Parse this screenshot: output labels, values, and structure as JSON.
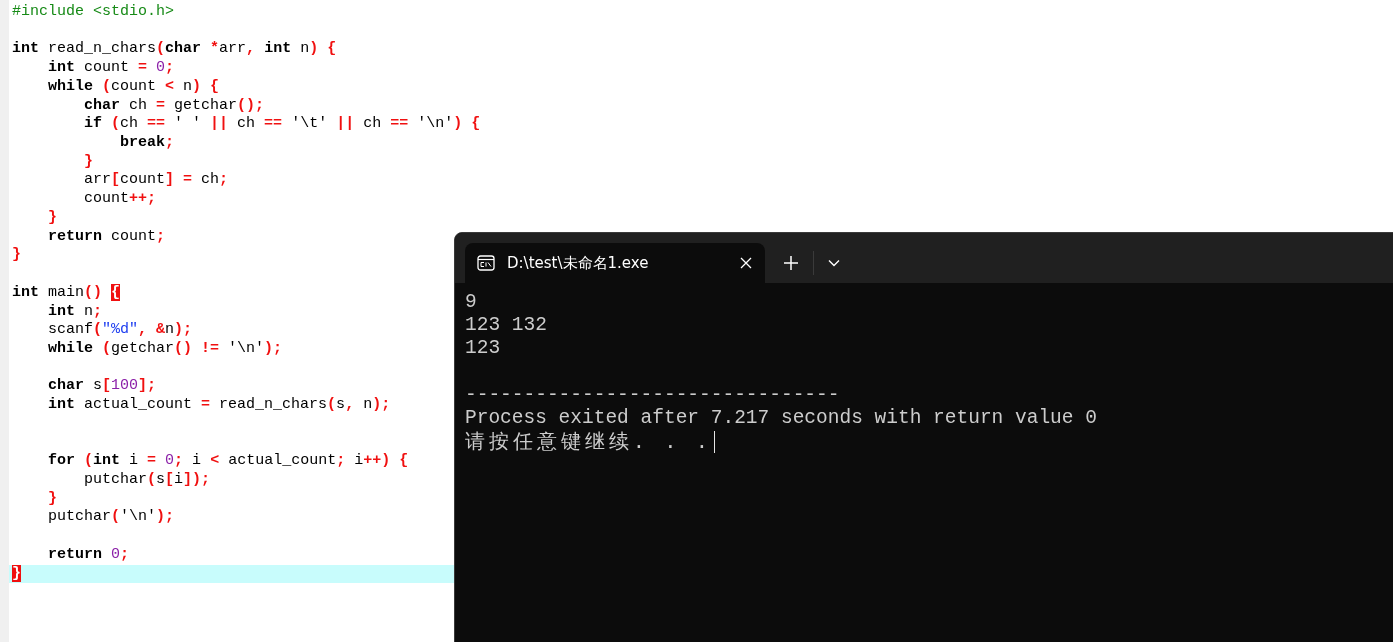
{
  "editor": {
    "lines": [
      {
        "kind": "code",
        "current": false,
        "tokens": [
          {
            "kind": "pre",
            "text": "#include <stdio.h>"
          }
        ]
      },
      {
        "kind": "blank",
        "current": false
      },
      {
        "kind": "code",
        "current": false,
        "tokens": [
          {
            "kind": "kw",
            "text": "int"
          },
          {
            "kind": "id",
            "text": " read_n_chars"
          },
          {
            "kind": "op",
            "text": "("
          },
          {
            "kind": "kw",
            "text": "char"
          },
          {
            "kind": "op",
            "text": " *"
          },
          {
            "kind": "id",
            "text": "arr"
          },
          {
            "kind": "op",
            "text": ","
          },
          {
            "kind": "kw",
            "text": " int"
          },
          {
            "kind": "id",
            "text": " n"
          },
          {
            "kind": "op",
            "text": ")"
          },
          {
            "kind": "op",
            "text": " {"
          }
        ]
      },
      {
        "kind": "code",
        "current": false,
        "tokens": [
          {
            "kind": "kw",
            "text": "    int"
          },
          {
            "kind": "id",
            "text": " count "
          },
          {
            "kind": "op",
            "text": "="
          },
          {
            "kind": "num",
            "text": " 0"
          },
          {
            "kind": "op",
            "text": ";"
          }
        ]
      },
      {
        "kind": "code",
        "current": false,
        "tokens": [
          {
            "kind": "kw",
            "text": "    while"
          },
          {
            "kind": "op",
            "text": " ("
          },
          {
            "kind": "id",
            "text": "count "
          },
          {
            "kind": "op",
            "text": "<"
          },
          {
            "kind": "id",
            "text": " n"
          },
          {
            "kind": "op",
            "text": ")"
          },
          {
            "kind": "op",
            "text": " {"
          }
        ]
      },
      {
        "kind": "code",
        "current": false,
        "tokens": [
          {
            "kind": "kw",
            "text": "        char"
          },
          {
            "kind": "id",
            "text": " ch "
          },
          {
            "kind": "op",
            "text": "="
          },
          {
            "kind": "id",
            "text": " getchar"
          },
          {
            "kind": "op",
            "text": "();"
          }
        ]
      },
      {
        "kind": "code",
        "current": false,
        "tokens": [
          {
            "kind": "kw",
            "text": "        if"
          },
          {
            "kind": "op",
            "text": " ("
          },
          {
            "kind": "id",
            "text": "ch "
          },
          {
            "kind": "op",
            "text": "=="
          },
          {
            "kind": "id",
            "text": " ' ' "
          },
          {
            "kind": "op",
            "text": "||"
          },
          {
            "kind": "id",
            "text": " ch "
          },
          {
            "kind": "op",
            "text": "=="
          },
          {
            "kind": "id",
            "text": " '\\t' "
          },
          {
            "kind": "op",
            "text": "||"
          },
          {
            "kind": "id",
            "text": " ch "
          },
          {
            "kind": "op",
            "text": "=="
          },
          {
            "kind": "id",
            "text": " '\\n'"
          },
          {
            "kind": "op",
            "text": ")"
          },
          {
            "kind": "op",
            "text": " {"
          }
        ]
      },
      {
        "kind": "code",
        "current": false,
        "tokens": [
          {
            "kind": "kw",
            "text": "            break"
          },
          {
            "kind": "op",
            "text": ";"
          }
        ]
      },
      {
        "kind": "code",
        "current": false,
        "tokens": [
          {
            "kind": "op",
            "text": "        }"
          }
        ]
      },
      {
        "kind": "code",
        "current": false,
        "tokens": [
          {
            "kind": "id",
            "text": "        arr"
          },
          {
            "kind": "op",
            "text": "["
          },
          {
            "kind": "id",
            "text": "count"
          },
          {
            "kind": "op",
            "text": "]"
          },
          {
            "kind": "op",
            "text": " ="
          },
          {
            "kind": "id",
            "text": " ch"
          },
          {
            "kind": "op",
            "text": ";"
          }
        ]
      },
      {
        "kind": "code",
        "current": false,
        "tokens": [
          {
            "kind": "id",
            "text": "        count"
          },
          {
            "kind": "op",
            "text": "++;"
          }
        ]
      },
      {
        "kind": "code",
        "current": false,
        "tokens": [
          {
            "kind": "op",
            "text": "    }"
          }
        ]
      },
      {
        "kind": "code",
        "current": false,
        "tokens": [
          {
            "kind": "kw",
            "text": "    return"
          },
          {
            "kind": "id",
            "text": " count"
          },
          {
            "kind": "op",
            "text": ";"
          }
        ]
      },
      {
        "kind": "code",
        "current": false,
        "tokens": [
          {
            "kind": "op",
            "text": "}"
          }
        ]
      },
      {
        "kind": "blank",
        "current": false
      },
      {
        "kind": "code",
        "current": false,
        "tokens": [
          {
            "kind": "kw",
            "text": "int"
          },
          {
            "kind": "id",
            "text": " main"
          },
          {
            "kind": "op",
            "text": "() "
          },
          {
            "kind": "match",
            "text": "{"
          }
        ]
      },
      {
        "kind": "code",
        "current": false,
        "tokens": [
          {
            "kind": "kw",
            "text": "    int"
          },
          {
            "kind": "id",
            "text": " n"
          },
          {
            "kind": "op",
            "text": ";"
          }
        ]
      },
      {
        "kind": "code",
        "current": false,
        "tokens": [
          {
            "kind": "id",
            "text": "    scanf"
          },
          {
            "kind": "op",
            "text": "("
          },
          {
            "kind": "str",
            "text": "\"%d\""
          },
          {
            "kind": "op",
            "text": ","
          },
          {
            "kind": "op",
            "text": " &"
          },
          {
            "kind": "id",
            "text": "n"
          },
          {
            "kind": "op",
            "text": ");"
          }
        ]
      },
      {
        "kind": "code",
        "current": false,
        "tokens": [
          {
            "kind": "kw",
            "text": "    while"
          },
          {
            "kind": "op",
            "text": " ("
          },
          {
            "kind": "id",
            "text": "getchar"
          },
          {
            "kind": "op",
            "text": "()"
          },
          {
            "kind": "op",
            "text": " !="
          },
          {
            "kind": "id",
            "text": " '\\n'"
          },
          {
            "kind": "op",
            "text": ");"
          }
        ]
      },
      {
        "kind": "blank",
        "current": false
      },
      {
        "kind": "code",
        "current": false,
        "tokens": [
          {
            "kind": "kw",
            "text": "    char"
          },
          {
            "kind": "id",
            "text": " s"
          },
          {
            "kind": "op",
            "text": "["
          },
          {
            "kind": "num",
            "text": "100"
          },
          {
            "kind": "op",
            "text": "];"
          }
        ]
      },
      {
        "kind": "code",
        "current": false,
        "tokens": [
          {
            "kind": "kw",
            "text": "    int"
          },
          {
            "kind": "id",
            "text": " actual_count "
          },
          {
            "kind": "op",
            "text": "="
          },
          {
            "kind": "id",
            "text": " read_n_chars"
          },
          {
            "kind": "op",
            "text": "("
          },
          {
            "kind": "id",
            "text": "s"
          },
          {
            "kind": "op",
            "text": ","
          },
          {
            "kind": "id",
            "text": " n"
          },
          {
            "kind": "op",
            "text": ");"
          }
        ]
      },
      {
        "kind": "blank",
        "current": false
      },
      {
        "kind": "blank",
        "current": false
      },
      {
        "kind": "code",
        "current": false,
        "tokens": [
          {
            "kind": "kw",
            "text": "    for"
          },
          {
            "kind": "op",
            "text": " ("
          },
          {
            "kind": "kw",
            "text": "int"
          },
          {
            "kind": "id",
            "text": " i "
          },
          {
            "kind": "op",
            "text": "="
          },
          {
            "kind": "num",
            "text": " 0"
          },
          {
            "kind": "op",
            "text": ";"
          },
          {
            "kind": "id",
            "text": " i "
          },
          {
            "kind": "op",
            "text": "<"
          },
          {
            "kind": "id",
            "text": " actual_count"
          },
          {
            "kind": "op",
            "text": ";"
          },
          {
            "kind": "id",
            "text": " i"
          },
          {
            "kind": "op",
            "text": "++)"
          },
          {
            "kind": "op",
            "text": " {"
          }
        ]
      },
      {
        "kind": "code",
        "current": false,
        "tokens": [
          {
            "kind": "id",
            "text": "        putchar"
          },
          {
            "kind": "op",
            "text": "("
          },
          {
            "kind": "id",
            "text": "s"
          },
          {
            "kind": "op",
            "text": "["
          },
          {
            "kind": "id",
            "text": "i"
          },
          {
            "kind": "op",
            "text": "]);"
          }
        ]
      },
      {
        "kind": "code",
        "current": false,
        "tokens": [
          {
            "kind": "op",
            "text": "    }"
          }
        ]
      },
      {
        "kind": "code",
        "current": false,
        "tokens": [
          {
            "kind": "id",
            "text": "    putchar"
          },
          {
            "kind": "op",
            "text": "("
          },
          {
            "kind": "id",
            "text": "'\\n'"
          },
          {
            "kind": "op",
            "text": ");"
          }
        ]
      },
      {
        "kind": "blank",
        "current": false
      },
      {
        "kind": "code",
        "current": false,
        "tokens": [
          {
            "kind": "kw",
            "text": "    return"
          },
          {
            "kind": "num",
            "text": " 0"
          },
          {
            "kind": "op",
            "text": ";"
          }
        ]
      },
      {
        "kind": "code",
        "current": true,
        "tokens": [
          {
            "kind": "match",
            "text": "}"
          }
        ]
      }
    ]
  },
  "terminal": {
    "tab": {
      "title": "D:\\test\\未命名1.exe",
      "selected": true
    },
    "lines": [
      {
        "kind": "text",
        "text": "9"
      },
      {
        "kind": "text",
        "text": "123 132"
      },
      {
        "kind": "text",
        "text": "123"
      },
      {
        "kind": "blank"
      },
      {
        "kind": "text",
        "text": "--------------------------------"
      },
      {
        "kind": "text",
        "text": "Process exited after 7.217 seconds with return value 0"
      },
      {
        "kind": "prompt",
        "text": "请按任意键继续. . ."
      }
    ]
  }
}
